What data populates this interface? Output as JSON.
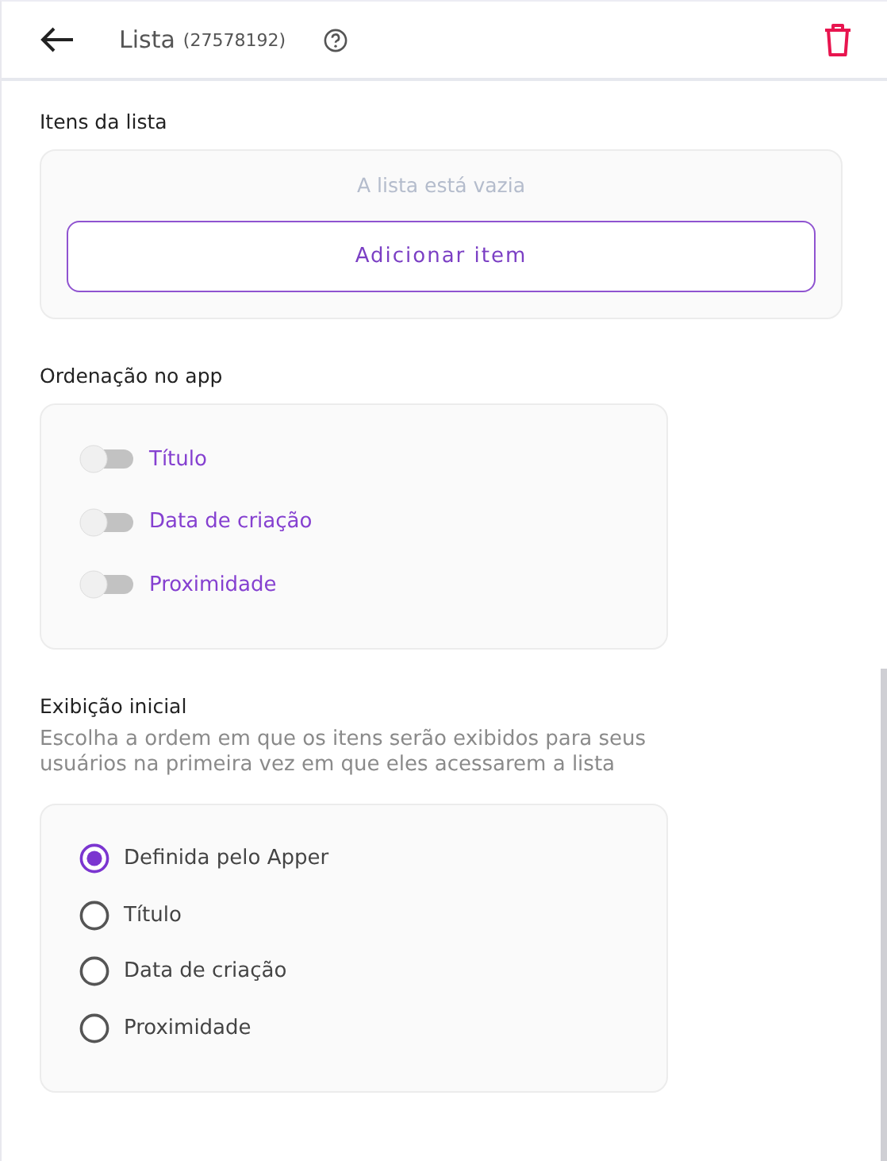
{
  "header": {
    "title": "Lista",
    "id": "(27578192)"
  },
  "items_section": {
    "heading": "Itens da lista",
    "empty_text": "A lista está vazia",
    "add_button": "Adicionar item"
  },
  "sorting_section": {
    "heading": "Ordenação no app",
    "toggles": [
      {
        "label": "Título",
        "on": false
      },
      {
        "label": "Data de criação",
        "on": false
      },
      {
        "label": "Proximidade",
        "on": false
      }
    ]
  },
  "initial_section": {
    "heading": "Exibição inicial",
    "description": "Escolha a ordem em que os itens serão exibidos para seus usuários na primeira vez em que eles acessarem a lista",
    "options": [
      {
        "label": "Definida pelo Apper",
        "selected": true
      },
      {
        "label": "Título",
        "selected": false
      },
      {
        "label": "Data de criação",
        "selected": false
      },
      {
        "label": "Proximidade",
        "selected": false
      }
    ]
  }
}
